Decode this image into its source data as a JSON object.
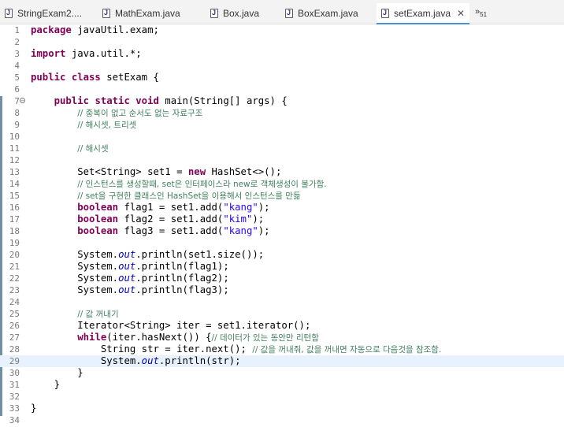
{
  "tabs": [
    {
      "label": "StringExam2....",
      "icon": "java-file-icon"
    },
    {
      "label": "MathExam.java",
      "icon": "java-file-icon"
    },
    {
      "label": "Box.java",
      "icon": "java-file-icon"
    },
    {
      "label": "BoxExam.java",
      "icon": "java-file-icon"
    },
    {
      "label": "setExam.java",
      "icon": "java-file-icon",
      "active": true
    }
  ],
  "overflow": {
    "symbol": "»",
    "count": "51"
  },
  "lines": [
    {
      "n": "1",
      "seg": [
        [
          "kw",
          "package"
        ],
        [
          "",
          "javaUtil.exam;"
        ]
      ]
    },
    {
      "n": "2",
      "seg": []
    },
    {
      "n": "3",
      "seg": [
        [
          "kw",
          "import"
        ],
        [
          "",
          "java.util.*;"
        ]
      ]
    },
    {
      "n": "4",
      "seg": []
    },
    {
      "n": "5",
      "seg": [
        [
          "kw",
          "public class"
        ],
        [
          "",
          "setExam {"
        ]
      ]
    },
    {
      "n": "6",
      "seg": []
    },
    {
      "n": "7",
      "seg": [
        [
          "",
          "    "
        ],
        [
          "kw",
          "public static void"
        ],
        [
          "",
          " main(String[] args) {"
        ]
      ],
      "fold": true
    },
    {
      "n": "8",
      "seg": [
        [
          "",
          "        "
        ],
        [
          "cm",
          "// 중복이 없고 순서도 없는 자료구조"
        ]
      ]
    },
    {
      "n": "9",
      "seg": [
        [
          "",
          "        "
        ],
        [
          "cm",
          "// 해시셋, 트리셋"
        ]
      ]
    },
    {
      "n": "10",
      "seg": []
    },
    {
      "n": "11",
      "seg": [
        [
          "",
          "        "
        ],
        [
          "cm",
          "// 해시셋"
        ]
      ]
    },
    {
      "n": "12",
      "seg": []
    },
    {
      "n": "13",
      "seg": [
        [
          "",
          "        Set<String> set1 = "
        ],
        [
          "kw",
          "new"
        ],
        [
          "",
          " HashSet<>();"
        ]
      ]
    },
    {
      "n": "14",
      "seg": [
        [
          "",
          "        "
        ],
        [
          "cm",
          "// 인스턴스를 생성할때, set은 인터페이스라 new로 객체생성이 불가함."
        ]
      ]
    },
    {
      "n": "15",
      "seg": [
        [
          "",
          "        "
        ],
        [
          "cm",
          "// set을 구현한 클래스인 HashSet을 이용해서 인스턴스를 만듦"
        ]
      ]
    },
    {
      "n": "16",
      "seg": [
        [
          "",
          "        "
        ],
        [
          "kw",
          "boolean"
        ],
        [
          "",
          " flag1 = set1.add("
        ],
        [
          "str",
          "\"kang\""
        ],
        [
          "",
          ");"
        ]
      ]
    },
    {
      "n": "17",
      "seg": [
        [
          "",
          "        "
        ],
        [
          "kw",
          "boolean"
        ],
        [
          "",
          " flag2 = set1.add("
        ],
        [
          "str",
          "\"kim\""
        ],
        [
          "",
          ");"
        ]
      ]
    },
    {
      "n": "18",
      "seg": [
        [
          "",
          "        "
        ],
        [
          "kw",
          "boolean"
        ],
        [
          "",
          " flag3 = set1.add("
        ],
        [
          "str",
          "\"kang\""
        ],
        [
          "",
          ");"
        ]
      ]
    },
    {
      "n": "19",
      "seg": []
    },
    {
      "n": "20",
      "seg": [
        [
          "",
          "        System."
        ],
        [
          "fld",
          "out"
        ],
        [
          "",
          ".println(set1.size());"
        ]
      ]
    },
    {
      "n": "21",
      "seg": [
        [
          "",
          "        System."
        ],
        [
          "fld",
          "out"
        ],
        [
          "",
          ".println(flag1);"
        ]
      ]
    },
    {
      "n": "22",
      "seg": [
        [
          "",
          "        System."
        ],
        [
          "fld",
          "out"
        ],
        [
          "",
          ".println(flag2);"
        ]
      ]
    },
    {
      "n": "23",
      "seg": [
        [
          "",
          "        System."
        ],
        [
          "fld",
          "out"
        ],
        [
          "",
          ".println(flag3);"
        ]
      ]
    },
    {
      "n": "24",
      "seg": []
    },
    {
      "n": "25",
      "seg": [
        [
          "",
          "        "
        ],
        [
          "cm",
          "// 값 꺼내기"
        ]
      ]
    },
    {
      "n": "26",
      "seg": [
        [
          "",
          "        Iterator<String> iter = set1.iterator();"
        ]
      ]
    },
    {
      "n": "27",
      "seg": [
        [
          "",
          "        "
        ],
        [
          "kw",
          "while"
        ],
        [
          "",
          "(iter.hasNext()) {"
        ],
        [
          "cm",
          "// 데이터가 있는 동안만 리턴함"
        ]
      ]
    },
    {
      "n": "28",
      "seg": [
        [
          "",
          "            String str = iter.next(); "
        ],
        [
          "cm",
          "// 값을 꺼내줘, 값을 꺼내면 자동으로 다음것을 참조함."
        ]
      ]
    },
    {
      "n": "29",
      "seg": [
        [
          "",
          "            System."
        ],
        [
          "fld",
          "out"
        ],
        [
          "",
          ".println(str);"
        ]
      ],
      "current": true
    },
    {
      "n": "30",
      "seg": [
        [
          "",
          "        }"
        ]
      ]
    },
    {
      "n": "31",
      "seg": [
        [
          "",
          "    }"
        ]
      ]
    },
    {
      "n": "32",
      "seg": []
    },
    {
      "n": "33",
      "seg": [
        [
          "",
          "}"
        ]
      ]
    },
    {
      "n": "34",
      "seg": []
    }
  ]
}
